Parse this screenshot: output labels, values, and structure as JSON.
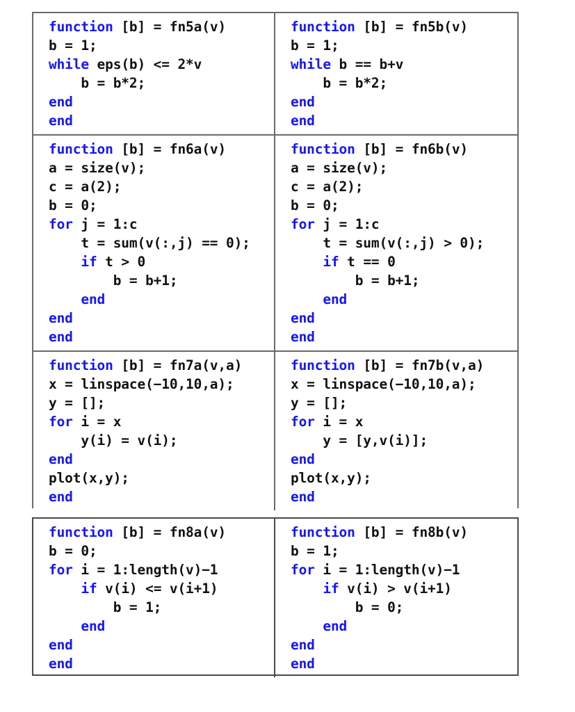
{
  "document": {
    "kind": "matlab-code-listing",
    "language": "MATLAB",
    "keyword_color": "#1414ff",
    "text_color": "#111111",
    "border_color": "#6a6a6a",
    "background_color": "#ffffff"
  },
  "tables": [
    {
      "id": "table-upper",
      "rows": [
        {
          "id": "row-fn5",
          "cells": [
            {
              "id": "cell-fn5a",
              "name": "fn5a",
              "lines": [
                [
                  {
                    "t": "function",
                    "k": true
                  },
                  {
                    "t": " [b] = fn5a(v)",
                    "k": false
                  }
                ],
                [
                  {
                    "t": "b = 1;",
                    "k": false
                  }
                ],
                [
                  {
                    "t": "while",
                    "k": true
                  },
                  {
                    "t": " eps(b) <= 2*v",
                    "k": false
                  }
                ],
                [
                  {
                    "t": "    b = b*2;",
                    "k": false
                  }
                ],
                [
                  {
                    "t": "end",
                    "k": true
                  }
                ],
                [
                  {
                    "t": "end",
                    "k": true
                  }
                ]
              ]
            },
            {
              "id": "cell-fn5b",
              "name": "fn5b",
              "lines": [
                [
                  {
                    "t": "function",
                    "k": true
                  },
                  {
                    "t": " [b] = fn5b(v)",
                    "k": false
                  }
                ],
                [
                  {
                    "t": "b = 1;",
                    "k": false
                  }
                ],
                [
                  {
                    "t": "while",
                    "k": true
                  },
                  {
                    "t": " b == b+v",
                    "k": false
                  }
                ],
                [
                  {
                    "t": "    b = b*2;",
                    "k": false
                  }
                ],
                [
                  {
                    "t": "end",
                    "k": true
                  }
                ],
                [
                  {
                    "t": "end",
                    "k": true
                  }
                ]
              ]
            }
          ]
        },
        {
          "id": "row-fn6",
          "cells": [
            {
              "id": "cell-fn6a",
              "name": "fn6a",
              "lines": [
                [
                  {
                    "t": "function",
                    "k": true
                  },
                  {
                    "t": " [b] = fn6a(v)",
                    "k": false
                  }
                ],
                [
                  {
                    "t": "a = size(v);",
                    "k": false
                  }
                ],
                [
                  {
                    "t": "c = a(2);",
                    "k": false
                  }
                ],
                [
                  {
                    "t": "b = 0;",
                    "k": false
                  }
                ],
                [
                  {
                    "t": "for",
                    "k": true
                  },
                  {
                    "t": " j = 1:c",
                    "k": false
                  }
                ],
                [
                  {
                    "t": "    t = sum(v(:,j) == 0);",
                    "k": false
                  }
                ],
                [
                  {
                    "t": "    ",
                    "k": false
                  },
                  {
                    "t": "if",
                    "k": true
                  },
                  {
                    "t": " t > 0",
                    "k": false
                  }
                ],
                [
                  {
                    "t": "        b = b+1;",
                    "k": false
                  }
                ],
                [
                  {
                    "t": "    ",
                    "k": false
                  },
                  {
                    "t": "end",
                    "k": true
                  }
                ],
                [
                  {
                    "t": "end",
                    "k": true
                  }
                ],
                [
                  {
                    "t": "end",
                    "k": true
                  }
                ]
              ]
            },
            {
              "id": "cell-fn6b",
              "name": "fn6b",
              "lines": [
                [
                  {
                    "t": "function",
                    "k": true
                  },
                  {
                    "t": " [b] = fn6b(v)",
                    "k": false
                  }
                ],
                [
                  {
                    "t": "a = size(v);",
                    "k": false
                  }
                ],
                [
                  {
                    "t": "c = a(2);",
                    "k": false
                  }
                ],
                [
                  {
                    "t": "b = 0;",
                    "k": false
                  }
                ],
                [
                  {
                    "t": "for",
                    "k": true
                  },
                  {
                    "t": " j = 1:c",
                    "k": false
                  }
                ],
                [
                  {
                    "t": "    t = sum(v(:,j) > 0);",
                    "k": false
                  }
                ],
                [
                  {
                    "t": "    ",
                    "k": false
                  },
                  {
                    "t": "if",
                    "k": true
                  },
                  {
                    "t": " t == 0",
                    "k": false
                  }
                ],
                [
                  {
                    "t": "        b = b+1;",
                    "k": false
                  }
                ],
                [
                  {
                    "t": "    ",
                    "k": false
                  },
                  {
                    "t": "end",
                    "k": true
                  }
                ],
                [
                  {
                    "t": "end",
                    "k": true
                  }
                ],
                [
                  {
                    "t": "end",
                    "k": true
                  }
                ]
              ]
            }
          ]
        },
        {
          "id": "row-fn7",
          "cells": [
            {
              "id": "cell-fn7a",
              "name": "fn7a",
              "lines": [
                [
                  {
                    "t": "function",
                    "k": true
                  },
                  {
                    "t": " [b] = fn7a(v,a)",
                    "k": false
                  }
                ],
                [
                  {
                    "t": "x = linspace(−10,10,a);",
                    "k": false
                  }
                ],
                [
                  {
                    "t": "y = [];",
                    "k": false
                  }
                ],
                [
                  {
                    "t": "for",
                    "k": true
                  },
                  {
                    "t": " i = x",
                    "k": false
                  }
                ],
                [
                  {
                    "t": "    y(i) = v(i);",
                    "k": false
                  }
                ],
                [
                  {
                    "t": "end",
                    "k": true
                  }
                ],
                [
                  {
                    "t": "plot(x,y);",
                    "k": false
                  }
                ],
                [
                  {
                    "t": "end",
                    "k": true
                  }
                ]
              ]
            },
            {
              "id": "cell-fn7b",
              "name": "fn7b",
              "lines": [
                [
                  {
                    "t": "function",
                    "k": true
                  },
                  {
                    "t": " [b] = fn7b(v,a)",
                    "k": false
                  }
                ],
                [
                  {
                    "t": "x = linspace(−10,10,a);",
                    "k": false
                  }
                ],
                [
                  {
                    "t": "y = [];",
                    "k": false
                  }
                ],
                [
                  {
                    "t": "for",
                    "k": true
                  },
                  {
                    "t": " i = x",
                    "k": false
                  }
                ],
                [
                  {
                    "t": "    y = [y,v(i)];",
                    "k": false
                  }
                ],
                [
                  {
                    "t": "end",
                    "k": true
                  }
                ],
                [
                  {
                    "t": "plot(x,y);",
                    "k": false
                  }
                ],
                [
                  {
                    "t": "end",
                    "k": true
                  }
                ]
              ]
            }
          ]
        }
      ]
    },
    {
      "id": "table-lower",
      "rows": [
        {
          "id": "row-fn8",
          "cells": [
            {
              "id": "cell-fn8a",
              "name": "fn8a",
              "lines": [
                [
                  {
                    "t": "function",
                    "k": true
                  },
                  {
                    "t": " [b] = fn8a(v)",
                    "k": false
                  }
                ],
                [
                  {
                    "t": "b = 0;",
                    "k": false
                  }
                ],
                [
                  {
                    "t": "for",
                    "k": true
                  },
                  {
                    "t": " i = 1:length(v)−1",
                    "k": false
                  }
                ],
                [
                  {
                    "t": "    ",
                    "k": false
                  },
                  {
                    "t": "if",
                    "k": true
                  },
                  {
                    "t": " v(i) <= v(i+1)",
                    "k": false
                  }
                ],
                [
                  {
                    "t": "        b = 1;",
                    "k": false
                  }
                ],
                [
                  {
                    "t": "    ",
                    "k": false
                  },
                  {
                    "t": "end",
                    "k": true
                  }
                ],
                [
                  {
                    "t": "end",
                    "k": true
                  }
                ],
                [
                  {
                    "t": "end",
                    "k": true
                  }
                ]
              ]
            },
            {
              "id": "cell-fn8b",
              "name": "fn8b",
              "lines": [
                [
                  {
                    "t": "function",
                    "k": true
                  },
                  {
                    "t": " [b] = fn8b(v)",
                    "k": false
                  }
                ],
                [
                  {
                    "t": "b = 1;",
                    "k": false
                  }
                ],
                [
                  {
                    "t": "for",
                    "k": true
                  },
                  {
                    "t": " i = 1:length(v)−1",
                    "k": false
                  }
                ],
                [
                  {
                    "t": "    ",
                    "k": false
                  },
                  {
                    "t": "if",
                    "k": true
                  },
                  {
                    "t": " v(i) > v(i+1)",
                    "k": false
                  }
                ],
                [
                  {
                    "t": "        b = 0;",
                    "k": false
                  }
                ],
                [
                  {
                    "t": "    ",
                    "k": false
                  },
                  {
                    "t": "end",
                    "k": true
                  }
                ],
                [
                  {
                    "t": "end",
                    "k": true
                  }
                ],
                [
                  {
                    "t": "end",
                    "k": true
                  }
                ]
              ]
            }
          ]
        }
      ]
    }
  ]
}
